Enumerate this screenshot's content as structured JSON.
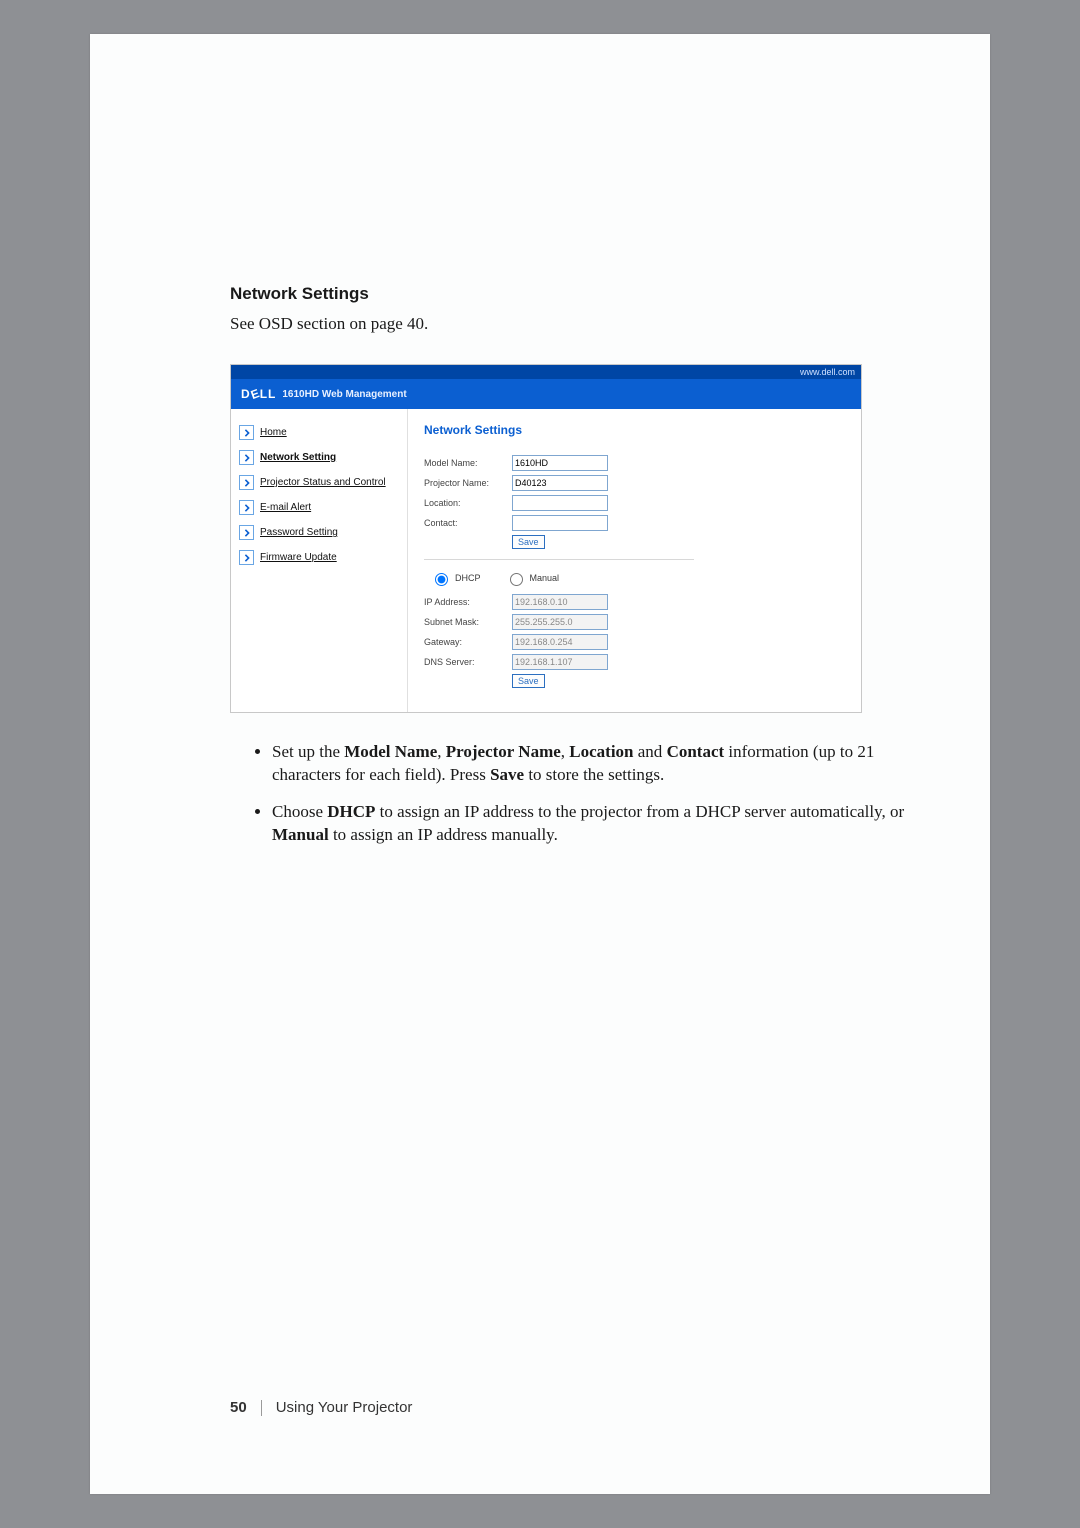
{
  "section": {
    "heading": "Network Settings",
    "intro": "See OSD section on page 40."
  },
  "screenshot": {
    "top_url": "www.dell.com",
    "brand": "DELL",
    "header_title": "1610HD Web Management",
    "sidebar": {
      "items": [
        {
          "label": "Home",
          "current": false
        },
        {
          "label": "Network Setting",
          "current": true
        },
        {
          "label": "Projector Status and Control",
          "current": false
        },
        {
          "label": "E-mail Alert",
          "current": false
        },
        {
          "label": "Password Setting",
          "current": false
        },
        {
          "label": "Firmware Update",
          "current": false
        }
      ]
    },
    "panel": {
      "title": "Network Settings",
      "top_form": {
        "rows": [
          {
            "label": "Model Name:",
            "value": "1610HD"
          },
          {
            "label": "Projector Name:",
            "value": "D40123"
          },
          {
            "label": "Location:",
            "value": ""
          },
          {
            "label": "Contact:",
            "value": ""
          }
        ],
        "save_label": "Save"
      },
      "radio": {
        "dhcp": "DHCP",
        "manual": "Manual",
        "selected": "dhcp"
      },
      "ip_form": {
        "rows": [
          {
            "label": "IP Address:",
            "value": "192.168.0.10"
          },
          {
            "label": "Subnet Mask:",
            "value": "255.255.255.0"
          },
          {
            "label": "Gateway:",
            "value": "192.168.0.254"
          },
          {
            "label": "DNS Server:",
            "value": "192.168.1.107"
          }
        ],
        "save_label": "Save"
      }
    }
  },
  "bullets": {
    "b1_part1": "Set up the ",
    "b1_bold1": "Model Name",
    "b1_sep1": ", ",
    "b1_bold2": "Projector Name",
    "b1_sep2": ", ",
    "b1_bold3": "Location",
    "b1_sep3": " and ",
    "b1_bold4": "Contact",
    "b1_part2": " information (up to 21 characters for each field). Press ",
    "b1_bold5": "Save",
    "b1_part3": " to store the settings.",
    "b2_part1": "Choose ",
    "b2_bold1": "DHCP",
    "b2_part2": " to assign an IP address to the projector from a DHCP server automatically, or ",
    "b2_bold2": "Manual",
    "b2_part3": " to assign an IP address manually."
  },
  "footer": {
    "page": "50",
    "chapter": "Using Your Projector"
  }
}
